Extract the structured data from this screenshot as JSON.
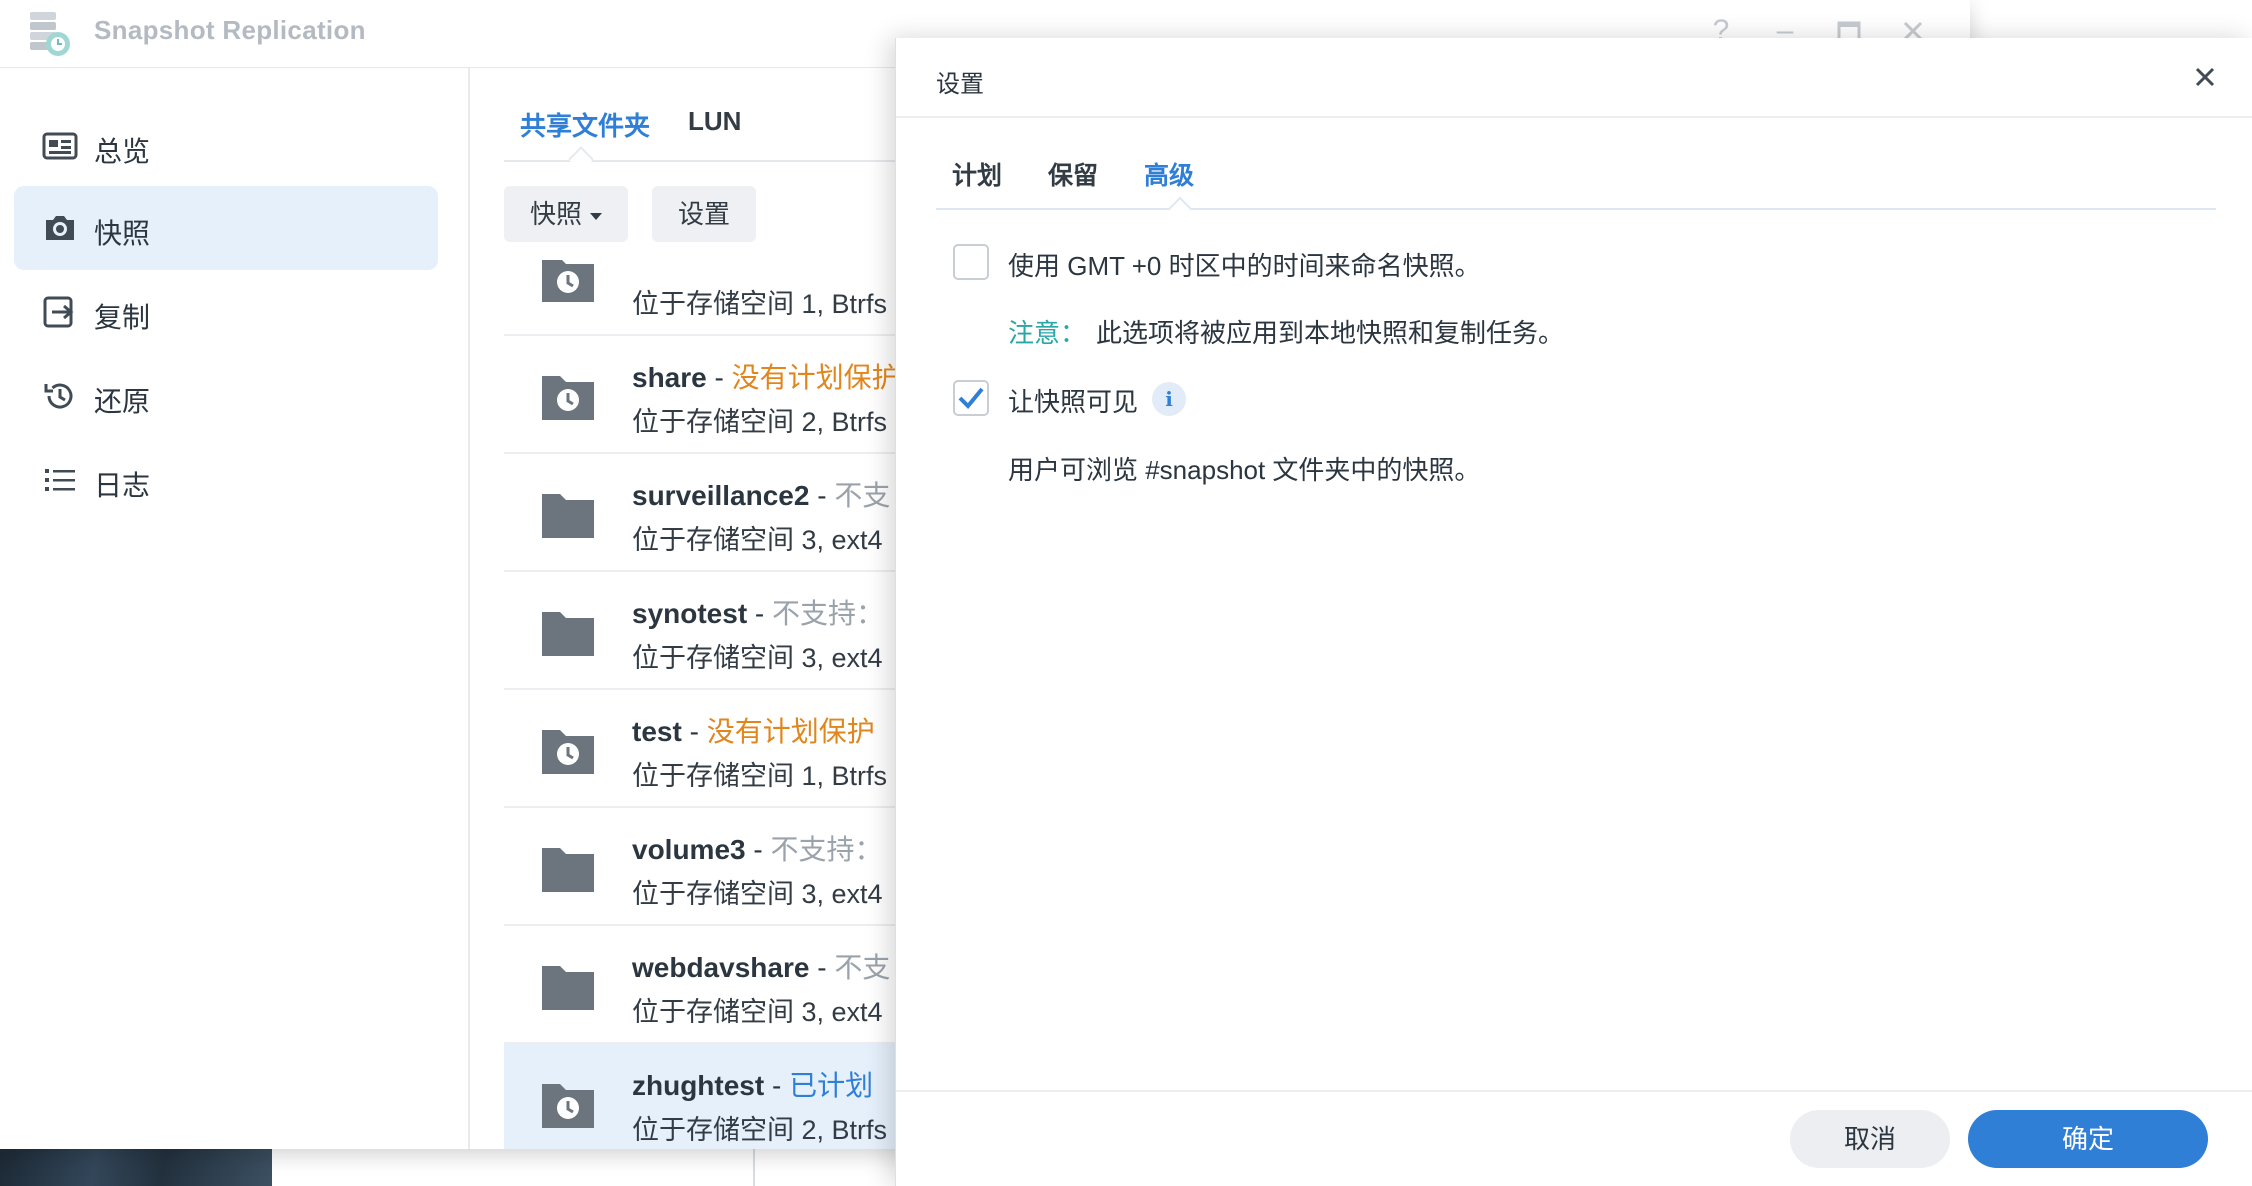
{
  "app": {
    "title": "Snapshot Replication"
  },
  "sidebar": {
    "items": [
      {
        "label": "总览",
        "icon": "overview-card-icon"
      },
      {
        "label": "快照",
        "icon": "camera-icon"
      },
      {
        "label": "复制",
        "icon": "replication-icon"
      },
      {
        "label": "还原",
        "icon": "restore-clock-icon"
      },
      {
        "label": "日志",
        "icon": "list-icon"
      }
    ],
    "active_index": 1
  },
  "main": {
    "tabs": [
      {
        "label": "共享文件夹"
      },
      {
        "label": "LUN"
      }
    ],
    "active_tab": 0,
    "toolbar": {
      "snapshot_label": "快照",
      "settings_label": "设置"
    },
    "rows": [
      {
        "name": "",
        "sep": "",
        "status": "",
        "status_type": "",
        "location": "位于存储空间 1, Btrfs",
        "icon": "snapshot-folder-icon"
      },
      {
        "name": "share",
        "sep": " - ",
        "status": "没有计划保护",
        "status_type": "orange",
        "location": "位于存储空间 2, Btrfs",
        "icon": "snapshot-folder-icon"
      },
      {
        "name": "surveillance2",
        "sep": " - ",
        "status": "不支",
        "status_type": "gray",
        "location": "位于存储空间 3, ext4",
        "icon": "folder-icon"
      },
      {
        "name": "synotest",
        "sep": " - ",
        "status": "不支持：",
        "status_type": "gray",
        "location": "位于存储空间 3, ext4",
        "icon": "folder-icon"
      },
      {
        "name": "test",
        "sep": " - ",
        "status": "没有计划保护",
        "status_type": "orange",
        "location": "位于存储空间 1, Btrfs",
        "icon": "snapshot-folder-icon"
      },
      {
        "name": "volume3",
        "sep": " - ",
        "status": "不支持：",
        "status_type": "gray",
        "location": "位于存储空间 3, ext4",
        "icon": "folder-icon"
      },
      {
        "name": "webdavshare",
        "sep": " - ",
        "status": "不支",
        "status_type": "gray",
        "location": "位于存储空间 3, ext4",
        "icon": "folder-icon"
      },
      {
        "name": "zhughtest",
        "sep": " - ",
        "status": "已计划",
        "status_type": "blue",
        "location": "位于存储空间 2, Btrfs",
        "icon": "snapshot-folder-icon",
        "selected": true
      }
    ]
  },
  "dialog": {
    "title": "设置",
    "tabs": [
      {
        "label": "计划"
      },
      {
        "label": "保留"
      },
      {
        "label": "高级"
      }
    ],
    "active_tab": 2,
    "options": {
      "gmt": {
        "label": "使用 GMT +0 时区中的时间来命名快照。",
        "checked": false
      },
      "note_key": "注意：",
      "note_text": "此选项将被应用到本地快照和复制任务。",
      "visible": {
        "label": "让快照可见",
        "checked": true
      },
      "visible_desc": "用户可浏览 #snapshot 文件夹中的快照。"
    },
    "buttons": {
      "cancel": "取消",
      "ok": "确定"
    }
  },
  "colors": {
    "accent": "#2f7fd6",
    "status_orange": "#e1861d",
    "status_gray": "#9aa3ab",
    "note_teal": "#2aa6a6",
    "selected_bg": "#e6f0fb"
  }
}
